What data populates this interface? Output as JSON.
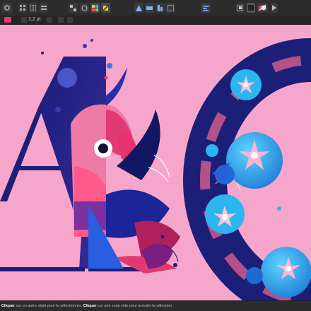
{
  "context_bar": {
    "size_value": "2,2 pt"
  },
  "status_bar": {
    "action_1": "Cliquer",
    "text_1": " sur un autre objet pour le sélectionner. ",
    "action_2": "Cliquer",
    "text_2": " sur une zone vide pour annuler la sélection."
  },
  "icons": {
    "toolbar": [
      "persona-icon",
      "grid-icon",
      "grid-icon",
      "layers-icon",
      "pixel-icon",
      "snapping-icon",
      "align-icon",
      "align-icon",
      "align-icon",
      "align-icon",
      "arrange-icon",
      "snapping-toggle-icon",
      "color-swatch-icon",
      "color-wheel-icon",
      "fullscreen-icon"
    ],
    "context": [
      "stroke-color-icon",
      "visibility-icon",
      "lock-icon",
      "copy-icon"
    ]
  },
  "colors": {
    "canvas_background": "#f7a6cb",
    "toolbar": "#2c2c2c",
    "letter_blue": "#1a1f7a",
    "accent_pink": "#ee3b74",
    "accent_cyan": "#2bb6f0"
  }
}
